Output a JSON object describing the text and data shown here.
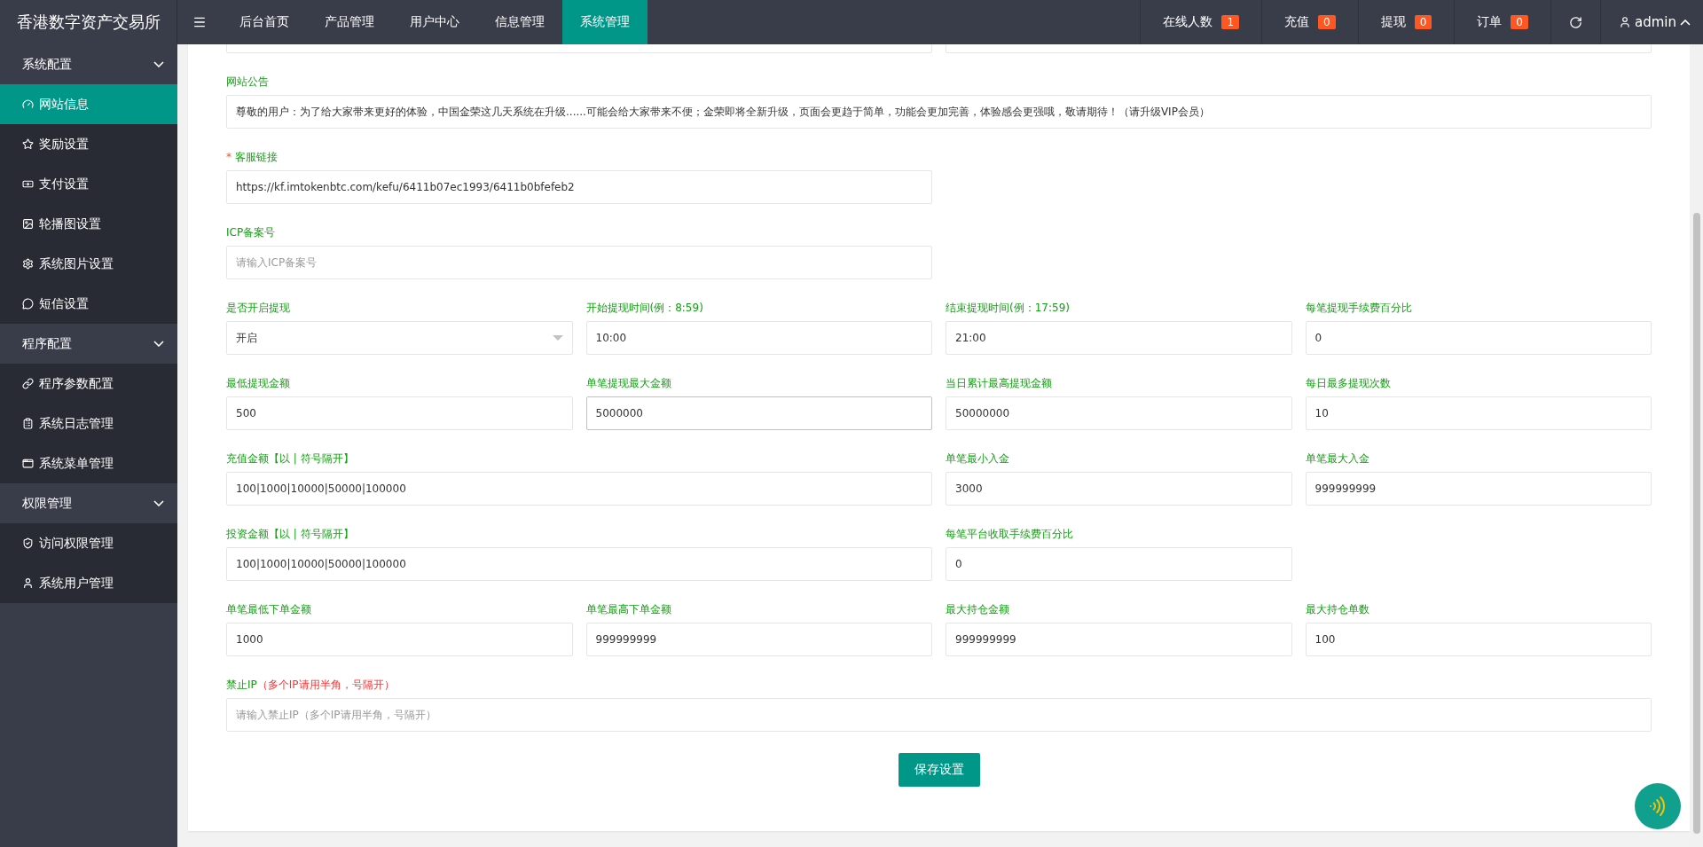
{
  "brand": "香港数字资产交易所",
  "nav": [
    {
      "label": "后台首页",
      "selected": false
    },
    {
      "label": "产品管理",
      "selected": false
    },
    {
      "label": "用户中心",
      "selected": false
    },
    {
      "label": "信息管理",
      "selected": false
    },
    {
      "label": "系统管理",
      "selected": true
    }
  ],
  "stats": [
    {
      "label": "在线人数",
      "count": "1"
    },
    {
      "label": "充值",
      "count": "0"
    },
    {
      "label": "提现",
      "count": "0"
    },
    {
      "label": "订单",
      "count": "0"
    }
  ],
  "user": "admin",
  "sidebar": [
    {
      "label": "系统配置",
      "expanded": true,
      "children": [
        {
          "label": "网站信息",
          "selected": true
        },
        {
          "label": "奖励设置",
          "selected": false
        },
        {
          "label": "支付设置",
          "selected": false
        },
        {
          "label": "轮播图设置",
          "selected": false
        },
        {
          "label": "系统图片设置",
          "selected": false
        },
        {
          "label": "短信设置",
          "selected": false
        }
      ]
    },
    {
      "label": "程序配置",
      "expanded": true,
      "children": [
        {
          "label": "程序参数配置",
          "selected": false
        },
        {
          "label": "系统日志管理",
          "selected": false
        },
        {
          "label": "系统菜单管理",
          "selected": false
        }
      ]
    },
    {
      "label": "权限管理",
      "expanded": true,
      "children": [
        {
          "label": "访问权限管理",
          "selected": false
        },
        {
          "label": "系统用户管理",
          "selected": false
        }
      ]
    }
  ],
  "fields": [
    {
      "kind": "input",
      "label": "网站公告",
      "value": "尊敬的用户：为了给大家带来更好的体验，中国金荣这几天系统在升级......可能会给大家带来不便；金荣即将全新升级，页面会更趋于简单，功能会更加完善，体验感会更强哦，敬请期待！（请升级VIP会员）"
    },
    {
      "kind": "input",
      "required_mark": "*",
      "label": "客服链接",
      "value": "https://kf.imtokenbtc.com/kefu/6411b07ec1993/6411b0bfefeb2"
    },
    {
      "kind": "input",
      "label": "ICP备案号",
      "placeholder": "请输入ICP备案号"
    },
    {
      "kind": "select",
      "label": "是否开启提现",
      "value": "开启"
    },
    {
      "kind": "input",
      "label": "开始提现时间(例：8:59)",
      "value": "10:00"
    },
    {
      "kind": "input",
      "label": "结束提现时间(例：17:59)",
      "value": "21:00"
    },
    {
      "kind": "input",
      "label": "每笔提现手续费百分比",
      "value": "0"
    },
    {
      "kind": "input",
      "label": "最低提现金额",
      "value": "500"
    },
    {
      "kind": "input",
      "label": "单笔提现最大金额",
      "value": "5000000",
      "focused": true
    },
    {
      "kind": "input",
      "label": "当日累计最高提现金额",
      "value": "50000000"
    },
    {
      "kind": "input",
      "label": "每日最多提现次数",
      "value": "10"
    },
    {
      "kind": "input",
      "label": "充值金额【以 | 符号隔开】",
      "value": "100|1000|10000|50000|100000"
    },
    {
      "kind": "input",
      "label": "单笔最小入金",
      "value": "3000"
    },
    {
      "kind": "input",
      "label": "单笔最大入金",
      "value": "999999999"
    },
    {
      "kind": "input",
      "label": "投资金额【以 | 符号隔开】",
      "value": "100|1000|10000|50000|100000"
    },
    {
      "kind": "input",
      "label": "每笔平台收取手续费百分比",
      "value": "0"
    },
    {
      "kind": "input",
      "label": "单笔最低下单金额",
      "value": "1000"
    },
    {
      "kind": "input",
      "label": "单笔最高下单金额",
      "value": "999999999"
    },
    {
      "kind": "input",
      "label": "最大持仓金额",
      "value": "999999999"
    },
    {
      "kind": "input",
      "label": "最大持仓单数",
      "value": "100"
    },
    {
      "kind": "input",
      "label": "禁止IP",
      "hint": "（多个IP请用半角，号隔开）",
      "placeholder": "请输入禁止IP（多个IP请用半角，号隔开）"
    }
  ],
  "save_button": "保存设置"
}
